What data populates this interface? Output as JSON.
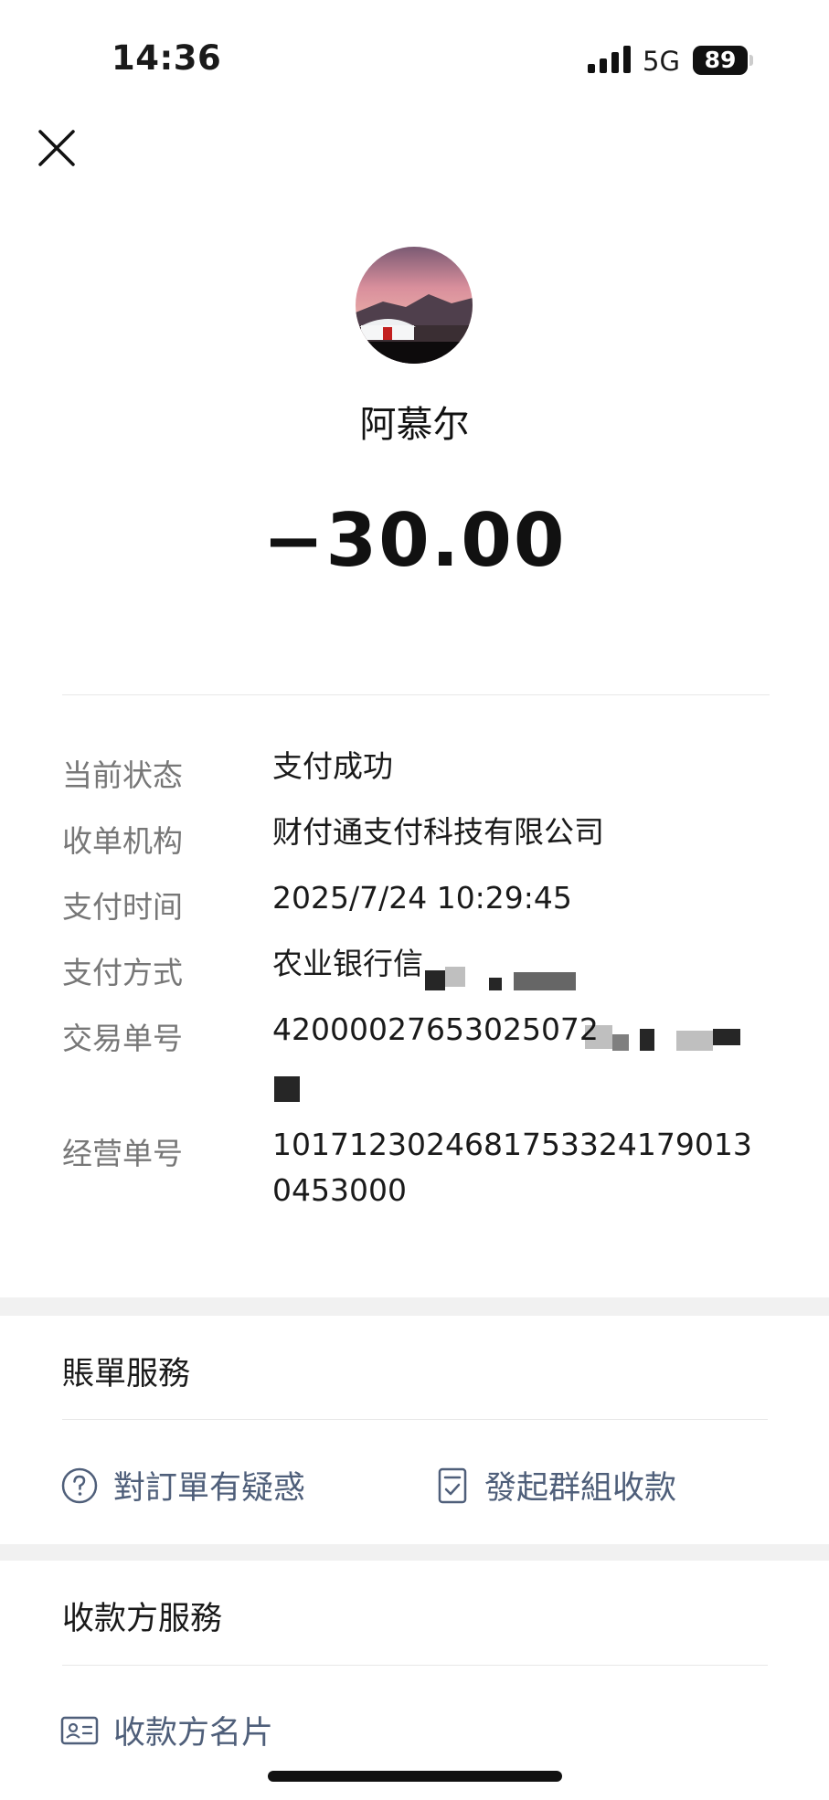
{
  "status_bar": {
    "time": "14:36",
    "network": "5G",
    "battery": "89"
  },
  "payee": {
    "name": "阿慕尔",
    "amount": "−30.00"
  },
  "details": [
    {
      "label": "当前状态",
      "value": "支付成功"
    },
    {
      "label": "收单机构",
      "value": "财付通支付科技有限公司"
    },
    {
      "label": "支付时间",
      "value": "2025/7/24 10:29:45"
    },
    {
      "label": "支付方式",
      "value": "农业银行信"
    },
    {
      "label": "交易单号",
      "value": "42000027653025072"
    },
    {
      "label": "经营单号",
      "value": "101712302468175332417901304530​00"
    }
  ],
  "bill_service": {
    "title": "賬單服務",
    "items": [
      {
        "label": "對訂單有疑惑",
        "icon": "question-circle-icon"
      },
      {
        "label": "發起群組收款",
        "icon": "document-check-icon"
      }
    ]
  },
  "payee_service": {
    "title": "收款方服務",
    "items": [
      {
        "label": "收款方名片",
        "icon": "id-card-icon"
      }
    ]
  },
  "colors": {
    "link_text": "#4f5f7a",
    "label_text": "#777777",
    "section_gap": "#f1f1f1"
  }
}
